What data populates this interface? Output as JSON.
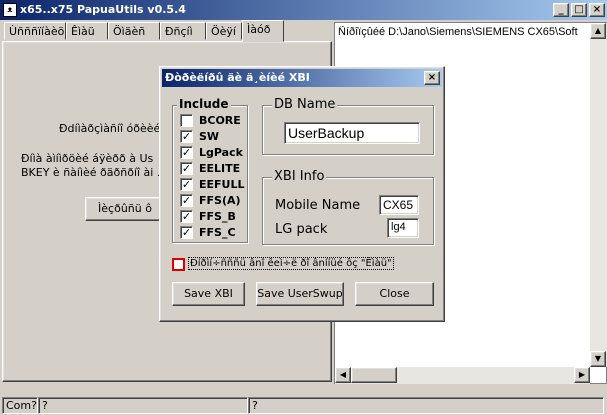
{
  "window": {
    "title": "x65..x75 PapuaUtils v0.5.4",
    "tabs": [
      "Ùñññïíàèö",
      "Êìàü",
      "Öìäèñ",
      "Ðñçíì",
      "Öèÿí",
      "Ìàóð"
    ]
  },
  "main_panel": {
    "text1": "Ðdíìàðçìàñíî óðèèé Óöèèé",
    "text2_line1": "Ðíìà àìíìðöèé áÿèðð à Us",
    "text2_line2": "BKEY è ñàíìèé ðäðñðíî ài .",
    "button": "Ìèçðûñü ô"
  },
  "log": {
    "line": "Ñíðîïçûéé D:\\Jano\\Siemens\\SIEMENS CX65\\Soft"
  },
  "statusbar": {
    "cell1": "Com?",
    "cell2": "?",
    "cell3": "?"
  },
  "dialog": {
    "title": "Ðòðèëíðû äè ä¸èíèé XBI",
    "include_legend": "Include",
    "items": [
      {
        "label": "BCORE",
        "checked": false
      },
      {
        "label": "SW",
        "checked": true
      },
      {
        "label": "LgPack",
        "checked": true
      },
      {
        "label": "EELITE",
        "checked": true
      },
      {
        "label": "EEFULL",
        "checked": true
      },
      {
        "label": "FFS(A)",
        "checked": true
      },
      {
        "label": "FFS_B",
        "checked": true
      },
      {
        "label": "FFS_C",
        "checked": true
      }
    ],
    "dbname_legend": "DB Name",
    "dbname_value": "UserBackup",
    "xbiinfo_legend": "XBI Info",
    "mobile_label": "Mobile Name",
    "mobile_value": "CX65",
    "lgpack_label": "LG pack",
    "lgpack_value": "lg4",
    "option_label": "Ðíðìí÷ñññü ânî êeì÷ë ðî ânííüé ôç \"Êìàü\"",
    "option_checked": false,
    "save_xbi": "Save XBI",
    "save_userswup": "Save UserSwup",
    "close": "Close"
  },
  "colors": {
    "title_start": "#0a246a",
    "title_end": "#a6caf0",
    "face": "#d4d0c8",
    "option_box": "#e00000"
  }
}
